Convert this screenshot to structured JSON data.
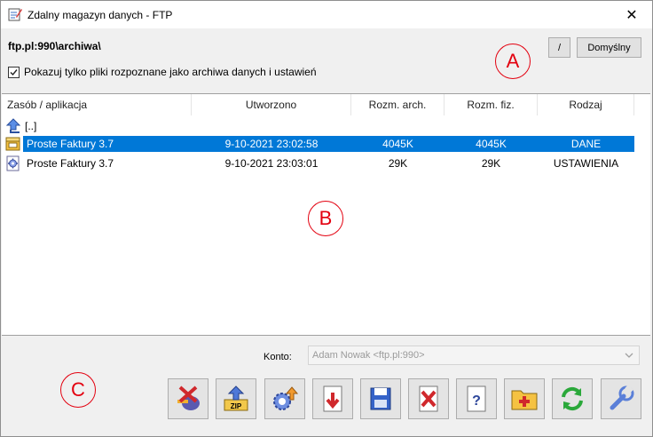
{
  "window": {
    "title": "Zdalny magazyn danych - FTP",
    "close_glyph": "✕"
  },
  "location": {
    "path": "ftp.pl:990\\archiwa\\",
    "root_button": "/",
    "default_button": "Domyślny"
  },
  "filter": {
    "label": "Pokazuj tylko pliki rozpoznane jako archiwa danych i ustawień",
    "checked": true
  },
  "markers": {
    "a": "A",
    "b": "B",
    "c": "C"
  },
  "list": {
    "columns": [
      "Zasób / aplikacja",
      "Utworzono",
      "Rozm. arch.",
      "Rozm. fiz.",
      "Rodzaj"
    ],
    "parent_item": "[..]",
    "rows": [
      {
        "name": "Proste Faktury 3.7",
        "created": "9-10-2021 23:02:58",
        "arch_size": "4045K",
        "phys_size": "4045K",
        "type": "DANE",
        "icon": "data-archive-icon",
        "selected": true
      },
      {
        "name": "Proste Faktury 3.7",
        "created": "9-10-2021 23:03:01",
        "arch_size": "29K",
        "phys_size": "29K",
        "type": "USTAWIENIA",
        "icon": "settings-archive-icon",
        "selected": false
      }
    ]
  },
  "account": {
    "label": "Konto:",
    "value": "Adam Nowak <ftp.pl:990>"
  },
  "toolbar": [
    {
      "name": "disconnect-button",
      "icon": "disconnect-icon"
    },
    {
      "name": "upload-zip-button",
      "icon": "upload-zip-icon"
    },
    {
      "name": "upload-settings-button",
      "icon": "upload-settings-icon"
    },
    {
      "name": "download-button",
      "icon": "download-icon"
    },
    {
      "name": "save-button",
      "icon": "save-icon"
    },
    {
      "name": "delete-button",
      "icon": "delete-icon"
    },
    {
      "name": "help-button",
      "icon": "help-icon"
    },
    {
      "name": "new-folder-button",
      "icon": "new-folder-icon"
    },
    {
      "name": "refresh-button",
      "icon": "refresh-icon"
    },
    {
      "name": "settings-button",
      "icon": "wrench-icon"
    }
  ],
  "colors": {
    "selection": "#0078d7",
    "marker": "#e3000f"
  }
}
